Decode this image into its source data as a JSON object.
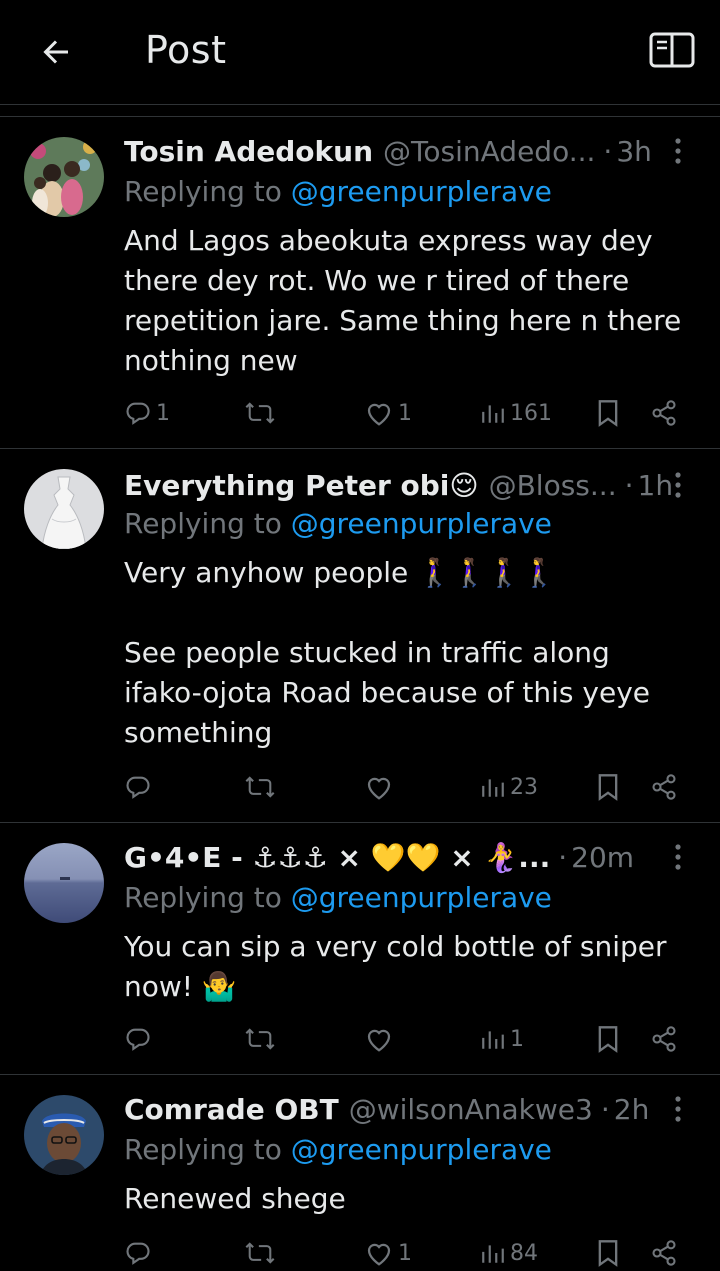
{
  "header": {
    "title": "Post"
  },
  "tweets": [
    {
      "name": "Tosin Adedokun",
      "handle": "@TosinAdedo...",
      "dot": "·",
      "time": "3h",
      "replying_prefix": "Replying to",
      "replying_to": "@greenpurplerave",
      "text": "And Lagos abeokuta express way dey there dey rot. Wo we r tired of there repetition jare. Same thing here n there nothing new",
      "replies": "1",
      "retweets": "",
      "likes": "1",
      "views": "161"
    },
    {
      "name": "Everything Peter obi😌",
      "handle": "@Bloss...",
      "dot": "·",
      "time": "1h",
      "replying_prefix": "Replying to",
      "replying_to": "@greenpurplerave",
      "text": "Very anyhow people 🚶‍♀️🚶‍♀️🚶‍♀️🚶‍♀️\n\nSee people stucked in traffic along ifako-ojota Road because of this yeye something",
      "replies": "",
      "retweets": "",
      "likes": "",
      "views": "23"
    },
    {
      "name": "G•4•E - ⚓⚓⚓ × 💛💛 × 🧜‍♀️...",
      "handle": "",
      "dot": "·",
      "time": "20m",
      "replying_prefix": "Replying to",
      "replying_to": "@greenpurplerave",
      "text": "You can sip a very cold bottle of sniper now! 🤷‍♂️",
      "replies": "",
      "retweets": "",
      "likes": "",
      "views": "1"
    },
    {
      "name": "Comrade OBT",
      "handle": "@wilsonAnakwe3",
      "dot": "·",
      "time": "2h",
      "replying_prefix": "Replying to",
      "replying_to": "@greenpurplerave",
      "text": "Renewed shege",
      "replies": "",
      "retweets": "",
      "likes": "1",
      "views": "84"
    }
  ],
  "colors": {
    "background": "#000000",
    "text": "#e7e9ea",
    "muted": "#71767b",
    "link": "#1d9bf0",
    "divider": "#2f3336"
  }
}
